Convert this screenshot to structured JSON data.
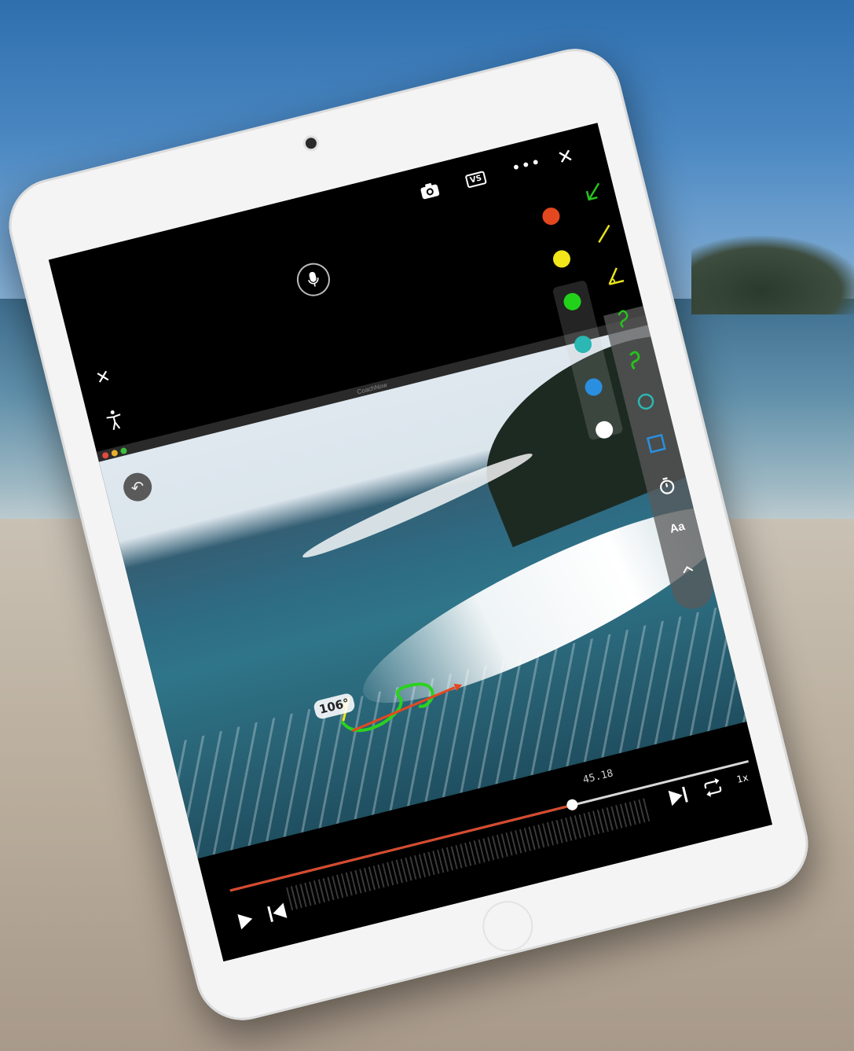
{
  "app": {
    "window_title": "CoachNow"
  },
  "topbar": {
    "close_icon": "close-icon",
    "camera_icon": "camera-icon",
    "vs_label": "VS",
    "more_icon": "more-icon",
    "mic_icon": "microphone-icon"
  },
  "left_tools": {
    "close_icon": "close-icon",
    "items": [
      "pose-icon",
      "face-frame-icon",
      "trash-icon"
    ],
    "undo_icon": "undo-icon"
  },
  "palette": {
    "colors": [
      "#e4481f",
      "#f2e51a",
      "#22d21a",
      "#2bb7b4",
      "#2a8fe0",
      "#ffffff"
    ]
  },
  "tools": {
    "items": [
      {
        "name": "arrow-tool",
        "color": "#27c21d"
      },
      {
        "name": "line-tool",
        "color": "#e8e21d"
      },
      {
        "name": "angle-tool",
        "color": "#e8e21d"
      },
      {
        "name": "curve-tool",
        "color": "#27c21d"
      },
      {
        "name": "freehand-tool",
        "color": "#27c21d"
      },
      {
        "name": "circle-tool",
        "color": "#2bb7b4"
      },
      {
        "name": "rectangle-tool",
        "color": "#2a8fe0"
      },
      {
        "name": "timer-tool",
        "color": "#ffffff"
      },
      {
        "name": "text-tool",
        "color": "#ffffff"
      },
      {
        "name": "collapse-tool",
        "color": "#ffffff"
      }
    ],
    "text_label": "Aa"
  },
  "video": {
    "angle_label": "106°"
  },
  "playback": {
    "time": "45.18",
    "progress": 0.66,
    "speed": "1x",
    "play_icon": "play-icon",
    "step_back_icon": "step-back-icon",
    "step_forward_icon": "step-forward-icon",
    "loop_icon": "loop-icon"
  }
}
